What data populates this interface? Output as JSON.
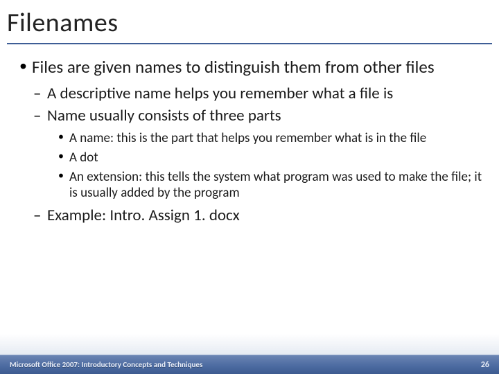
{
  "title": "Filenames",
  "bullets": {
    "l1_0": "Files are given names to distinguish them from other files",
    "l2_0": "A descriptive name helps you remember what a file is",
    "l2_1": "Name usually consists of three parts",
    "l3_0": "A name:  this is the part that helps you remember what is in the file",
    "l3_1": "A dot",
    "l3_2": "An extension:  this tells the system what program was used to make the file; it is usually added by the program",
    "l2_2": "Example:  Intro. Assign 1. docx"
  },
  "footer": {
    "left": "Microsoft Office 2007: Introductory Concepts and Techniques",
    "page": "26"
  }
}
